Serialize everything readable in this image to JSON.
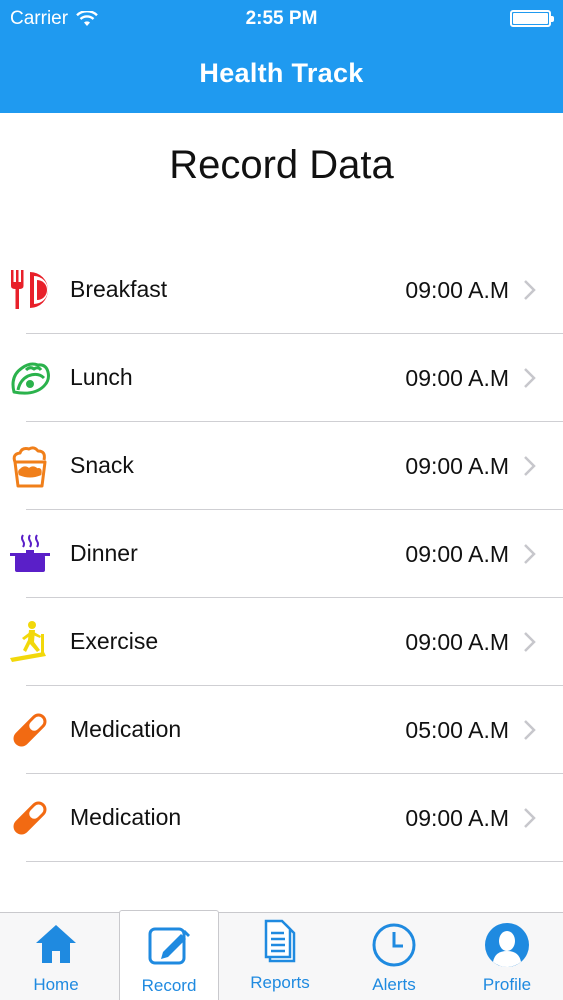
{
  "status_bar": {
    "carrier": "Carrier",
    "time": "2:55 PM"
  },
  "header": {
    "title": "Health Track"
  },
  "page": {
    "title": "Record Data"
  },
  "records": [
    {
      "label": "Breakfast",
      "time": "09:00 A.M",
      "icon": "fork-plate-icon",
      "color": "#e8202a"
    },
    {
      "label": "Lunch",
      "time": "09:00 A.M",
      "icon": "taco-icon",
      "color": "#2bb24c"
    },
    {
      "label": "Snack",
      "time": "09:00 A.M",
      "icon": "popcorn-icon",
      "color": "#f07f1a"
    },
    {
      "label": "Dinner",
      "time": "09:00 A.M",
      "icon": "cooking-pot-icon",
      "color": "#5a1fc8"
    },
    {
      "label": "Exercise",
      "time": "09:00 A.M",
      "icon": "treadmill-icon",
      "color": "#f2d80a"
    },
    {
      "label": "Medication",
      "time": "05:00 A.M",
      "icon": "pill-icon",
      "color": "#f26a12"
    },
    {
      "label": "Medication",
      "time": "09:00 A.M",
      "icon": "pill-icon",
      "color": "#f26a12"
    }
  ],
  "tabs": [
    {
      "label": "Home",
      "icon": "home-icon",
      "active": false
    },
    {
      "label": "Record",
      "icon": "edit-icon",
      "active": true
    },
    {
      "label": "Reports",
      "icon": "reports-icon",
      "active": false
    },
    {
      "label": "Alerts",
      "icon": "clock-icon",
      "active": false
    },
    {
      "label": "Profile",
      "icon": "user-icon",
      "active": false
    }
  ],
  "colors": {
    "accent": "#1f9af0",
    "tab_tint": "#1f8ae0",
    "separator": "#cfcfd3"
  }
}
